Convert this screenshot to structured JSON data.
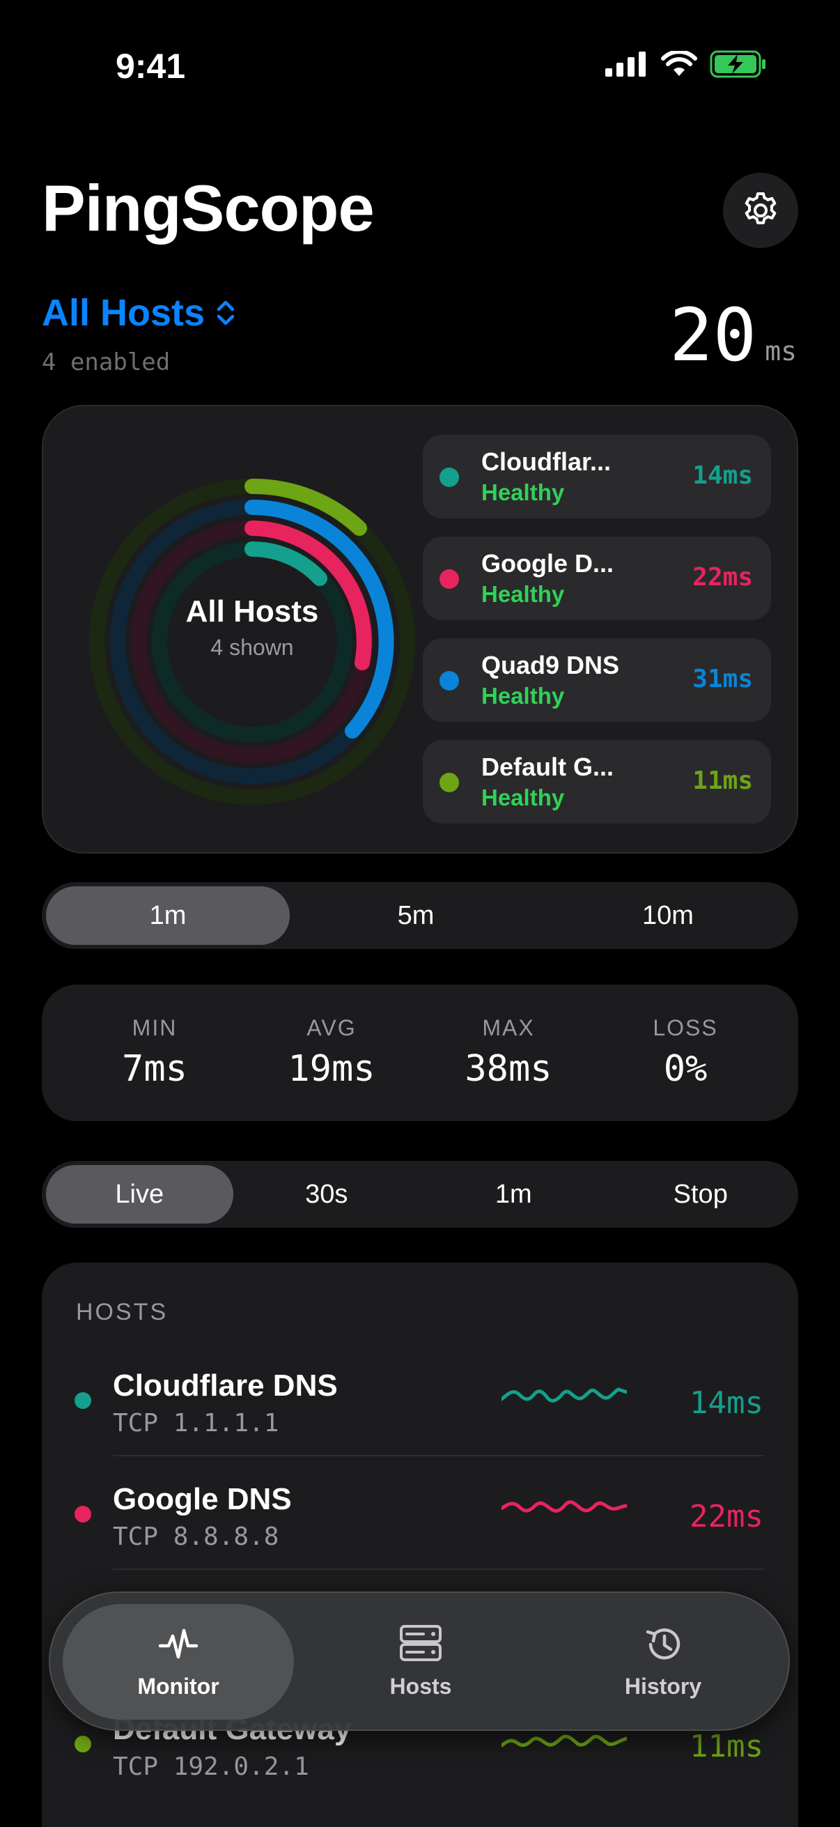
{
  "status_bar": {
    "time": "9:41"
  },
  "header": {
    "title": "PingScope",
    "host_selector": "All Hosts",
    "enabled_count": "4 enabled",
    "current_latency": "20",
    "latency_unit": "ms"
  },
  "ring": {
    "center_title": "All Hosts",
    "center_subtitle": "4 shown",
    "legend": [
      {
        "name": "Cloudflar...",
        "status": "Healthy",
        "latency": "14ms",
        "color": "#14a08c"
      },
      {
        "name": "Google D...",
        "status": "Healthy",
        "latency": "22ms",
        "color": "#e8245f"
      },
      {
        "name": "Quad9 DNS",
        "status": "Healthy",
        "latency": "31ms",
        "color": "#0a84d8"
      },
      {
        "name": "Default G...",
        "status": "Healthy",
        "latency": "11ms",
        "color": "#6ea514"
      }
    ]
  },
  "range_segment": {
    "options": [
      "1m",
      "5m",
      "10m"
    ],
    "selected": "1m"
  },
  "stats": {
    "min_label": "MIN",
    "min_value": "7ms",
    "avg_label": "AVG",
    "avg_value": "19ms",
    "max_label": "MAX",
    "max_value": "38ms",
    "loss_label": "LOSS",
    "loss_value": "0%"
  },
  "interval_segment": {
    "options": [
      "Live",
      "30s",
      "1m",
      "Stop"
    ],
    "selected": "Live"
  },
  "hosts": {
    "header": "HOSTS",
    "rows": [
      {
        "name": "Cloudflare DNS",
        "address": "TCP 1.1.1.1",
        "latency": "14ms",
        "color": "#14a08c"
      },
      {
        "name": "Google DNS",
        "address": "TCP 8.8.8.8",
        "latency": "22ms",
        "color": "#e8245f"
      },
      {
        "name": "Default Gateway",
        "address": "TCP 192.0.2.1",
        "latency": "11ms",
        "color": "#6ea514"
      }
    ]
  },
  "tabbar": {
    "tabs": [
      {
        "label": "Monitor",
        "icon": "waveform-icon"
      },
      {
        "label": "Hosts",
        "icon": "server-icon"
      },
      {
        "label": "History",
        "icon": "history-icon"
      }
    ],
    "selected": "Monitor"
  },
  "colors": {
    "accent": "#0a84ff",
    "healthy": "#30d158",
    "background": "#000000",
    "card": "#1c1c1e"
  }
}
